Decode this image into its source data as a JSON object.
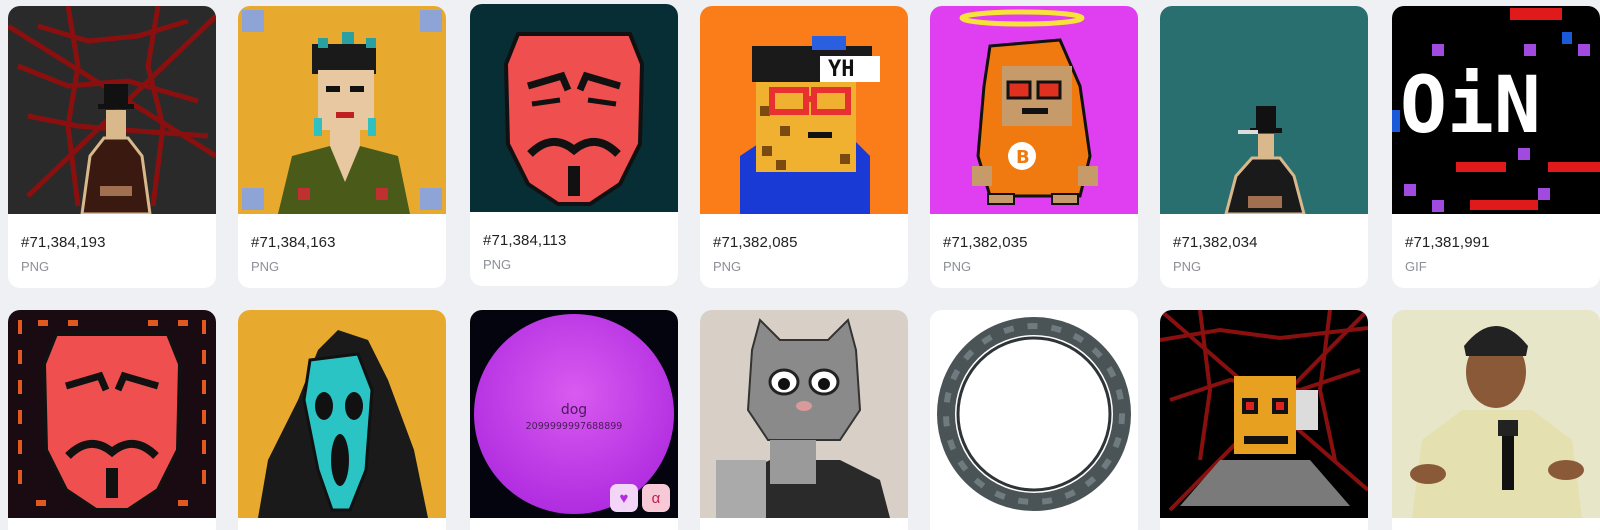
{
  "cards_row1": [
    {
      "number": "#71,384,193",
      "type": "PNG"
    },
    {
      "number": "#71,384,163",
      "type": "PNG"
    },
    {
      "number": "#71,384,113",
      "type": "PNG"
    },
    {
      "number": "#71,382,085",
      "type": "PNG"
    },
    {
      "number": "#71,382,035",
      "type": "PNG"
    },
    {
      "number": "#71,382,034",
      "type": "PNG"
    },
    {
      "number": "#71,381,991",
      "type": "GIF"
    }
  ],
  "cards_row2": [
    {
      "thumb": "pixel mask with binary pattern"
    },
    {
      "thumb": "pixel ghostface"
    },
    {
      "thumb": "dog orb",
      "orb_title": "dog",
      "orb_number": "2099999997688899"
    },
    {
      "thumb": "cat mask photo"
    },
    {
      "thumb": "stargate ring"
    },
    {
      "thumb": "pixel skull pyramid"
    },
    {
      "thumb": "man with microphone photo"
    }
  ],
  "badges": {
    "heart": "♥",
    "alpha": "α"
  },
  "colors": {
    "page_bg": "#eef0f3",
    "card_bg": "#ffffff",
    "heart_badge": "#f3d6f7",
    "alpha_badge": "#f7c8d6"
  }
}
